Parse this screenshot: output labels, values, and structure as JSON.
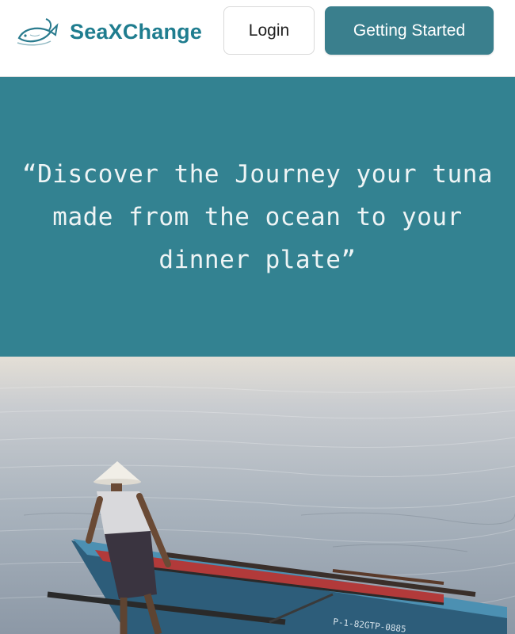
{
  "header": {
    "brand_name": "SeaXChange",
    "login_label": "Login",
    "get_started_label": "Getting Started",
    "logo_icon": "fish-logo-icon"
  },
  "hero": {
    "quote": "“Discover the Journey your tuna made from the ocean to your dinner plate”",
    "quote_background": "#338291"
  },
  "photo": {
    "subject": "fisherman-on-boat",
    "boat_hull_text": "P-1-82GTP-0885"
  },
  "colors": {
    "brand": "#1f7d8f",
    "accent": "#3a7f8d",
    "hero": "#338291"
  }
}
